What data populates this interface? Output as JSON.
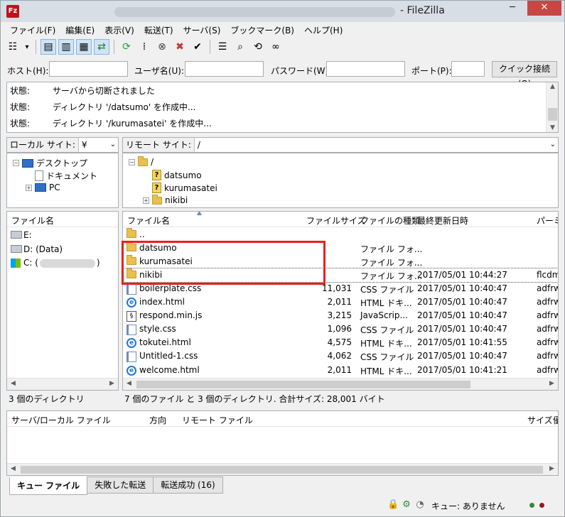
{
  "window": {
    "title": "- FileZilla",
    "min_glyph": "─",
    "max_glyph": "□",
    "close_glyph": "✕",
    "app_icon_text": "Fz"
  },
  "menu": [
    "ファイル(F)",
    "編集(E)",
    "表示(V)",
    "転送(T)",
    "サーバ(S)",
    "ブックマーク(B)",
    "ヘルプ(H)"
  ],
  "toolbar": [
    {
      "name": "site-manager-icon",
      "glyph": "☷",
      "selected": false
    },
    {
      "name": "dropdown-arrow-icon",
      "glyph": "▾",
      "selected": false
    },
    {
      "name": "toggle-log-icon",
      "glyph": "▤",
      "selected": true
    },
    {
      "name": "toggle-local-tree-icon",
      "glyph": "▥",
      "selected": true
    },
    {
      "name": "toggle-remote-tree-icon",
      "glyph": "▦",
      "selected": true
    },
    {
      "name": "transfer-queue-icon",
      "glyph": "⇄",
      "selected": true
    },
    {
      "name": "refresh-icon",
      "glyph": "⟳",
      "selected": false
    },
    {
      "name": "process-queue-icon",
      "glyph": "⁞",
      "selected": false
    },
    {
      "name": "cancel-icon",
      "glyph": "⊗",
      "selected": false
    },
    {
      "name": "disconnect-icon",
      "glyph": "✖",
      "selected": false
    },
    {
      "name": "reconnect-icon",
      "glyph": "✔",
      "selected": false
    },
    {
      "name": "filter-icon",
      "glyph": "☰",
      "selected": false
    },
    {
      "name": "search-icon",
      "glyph": "⌕",
      "selected": false
    },
    {
      "name": "compare-icon",
      "glyph": "⟲",
      "selected": false
    },
    {
      "name": "binoculars-icon",
      "glyph": "∞",
      "selected": false
    }
  ],
  "quickconnect": {
    "host_label": "ホスト(H):",
    "user_label": "ユーザ名(U):",
    "pass_label": "パスワード(W):",
    "port_label": "ポート(P):",
    "host_value": "",
    "user_value": "",
    "pass_value": "",
    "port_value": "",
    "button": "クイック接続(Q)"
  },
  "log": [
    {
      "key": "状態:",
      "msg": "サーバから切断されました"
    },
    {
      "key": "状態:",
      "msg": "ディレクトリ '/datsumo' を作成中..."
    },
    {
      "key": "状態:",
      "msg": "ディレクトリ '/kurumasatei' を作成中..."
    }
  ],
  "local": {
    "site_label": "ローカル サイト:",
    "site_value": "¥",
    "tree": [
      {
        "label": "デスクトップ",
        "expander": "−",
        "icon": "desktop"
      },
      {
        "label": "ドキュメント",
        "expander": "",
        "icon": "documents"
      },
      {
        "label": "PC",
        "expander": "+",
        "icon": "pc"
      }
    ],
    "list_header": "ファイル名",
    "drives": [
      {
        "label": "E:",
        "icon": "drive"
      },
      {
        "label": "D: (Data)",
        "icon": "drive"
      },
      {
        "label": "C: (",
        "suffix": ")",
        "icon": "windows"
      }
    ],
    "status": "3 個のディレクトリ"
  },
  "remote": {
    "site_label": "リモート サイト:",
    "site_value": "/",
    "tree": [
      {
        "label": "/",
        "expander": "−",
        "icon": "folder"
      },
      {
        "label": "datsumo",
        "expander": "",
        "icon": "unknown"
      },
      {
        "label": "kurumasatei",
        "expander": "",
        "icon": "unknown"
      },
      {
        "label": "nikibi",
        "expander": "+",
        "icon": "folder"
      }
    ],
    "columns": [
      "ファイル名",
      "ファイルサイズ",
      "ファイルの種類",
      "最終更新日時",
      "パーミッ"
    ],
    "files": [
      {
        "name": "..",
        "size": "",
        "type": "",
        "date": "",
        "perm": "",
        "icon": "folder"
      },
      {
        "name": "datsumo",
        "size": "",
        "type": "ファイル フォ...",
        "date": "",
        "perm": "",
        "icon": "folder"
      },
      {
        "name": "kurumasatei",
        "size": "",
        "type": "ファイル フォ...",
        "date": "",
        "perm": "",
        "icon": "folder"
      },
      {
        "name": "nikibi",
        "size": "",
        "type": "ファイル フォ...",
        "date": "2017/05/01 10:44:27",
        "perm": "flcdm",
        "icon": "folder"
      },
      {
        "name": "boilerplate.css",
        "size": "11,031",
        "type": "CSS ファイル",
        "date": "2017/05/01 10:40:47",
        "perm": "adfrw",
        "icon": "css"
      },
      {
        "name": "index.html",
        "size": "2,011",
        "type": "HTML ドキ...",
        "date": "2017/05/01 10:40:47",
        "perm": "adfrw",
        "icon": "html"
      },
      {
        "name": "respond.min.js",
        "size": "3,215",
        "type": "JavaScrip...",
        "date": "2017/05/01 10:40:47",
        "perm": "adfrw",
        "icon": "js"
      },
      {
        "name": "style.css",
        "size": "1,096",
        "type": "CSS ファイル",
        "date": "2017/05/01 10:40:47",
        "perm": "adfrw",
        "icon": "css"
      },
      {
        "name": "tokutei.html",
        "size": "4,575",
        "type": "HTML ドキ...",
        "date": "2017/05/01 10:41:55",
        "perm": "adfrw",
        "icon": "html"
      },
      {
        "name": "Untitled-1.css",
        "size": "4,062",
        "type": "CSS ファイル",
        "date": "2017/05/01 10:40:47",
        "perm": "adfrw",
        "icon": "css"
      },
      {
        "name": "welcome.html",
        "size": "2,011",
        "type": "HTML ドキ...",
        "date": "2017/05/01 10:41:21",
        "perm": "adfrw",
        "icon": "html"
      }
    ],
    "status": "7 個のファイル と 3 個のディレクトリ. 合計サイズ: 28,001 バイト"
  },
  "queue": {
    "columns": [
      "サーバ/ローカル ファイル",
      "方向",
      "リモート ファイル",
      "サイズ",
      "優"
    ]
  },
  "tabs": [
    "キュー ファイル",
    "失敗した転送",
    "転送成功 (16)"
  ],
  "statusbar": {
    "queue_text": "キュー: ありません",
    "lock_glyph": "🔒",
    "gear_glyph": "⚙",
    "speed_glyph": "◔"
  },
  "colors": {
    "highlight": "#e8201b",
    "dot_left": "#2e8b3a",
    "dot_right": "#8b1e1e"
  }
}
